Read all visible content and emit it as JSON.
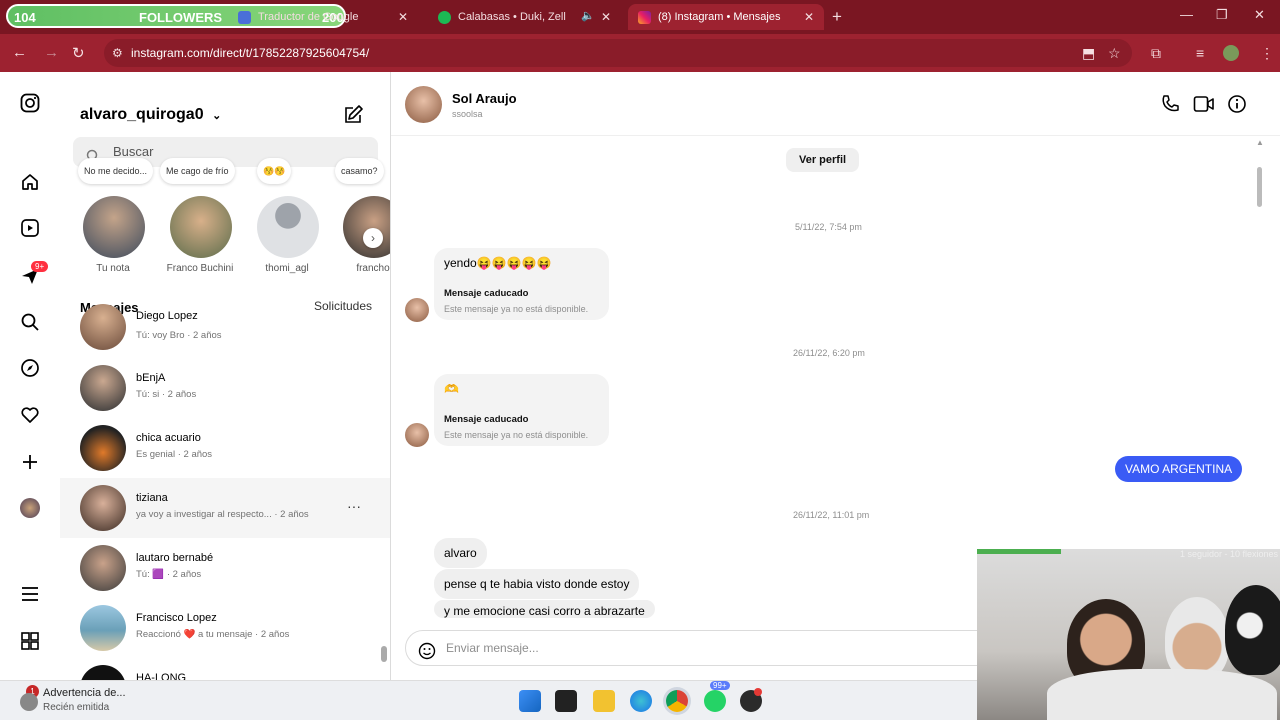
{
  "browser": {
    "overlay": {
      "left_num": "104",
      "label": "FOLLOWERS",
      "right_num": "200"
    },
    "tabs": [
      {
        "title": "Traductor de Google",
        "active": false
      },
      {
        "title": "Calabasas • Duki, Zell",
        "active": false
      },
      {
        "title": "(8) Instagram • Mensajes",
        "active": true
      }
    ],
    "url": "instagram.com/direct/t/17852287925604754/"
  },
  "rail": {
    "notif_badge": "9+"
  },
  "inbox": {
    "username": "alvaro_quiroga0",
    "search_placeholder": "Buscar",
    "notes": [
      {
        "bubble": "No me decido...",
        "name": "Tu nota"
      },
      {
        "bubble": "Me cago de frío",
        "name": "Franco Buchini"
      },
      {
        "bubble": "😚😚",
        "name": "thomi_agl"
      },
      {
        "bubble": "casamo?",
        "name": "francho"
      }
    ],
    "mensajes_label": "Mensajes",
    "solicitudes_label": "Solicitudes",
    "conversations": [
      {
        "name": "Diego Lopez",
        "preview": "Tú: voy Bro · 2 años"
      },
      {
        "name": "bEnjA",
        "preview": "Tú: si · 2 años"
      },
      {
        "name": "chica acuario",
        "preview": "Es genial · 2 años"
      },
      {
        "name": "tiziana",
        "preview": "ya voy a investigar al respecto... · 2 años"
      },
      {
        "name": "lautaro bernabé",
        "preview": "Tú: 🟪 · 2 años"
      },
      {
        "name": "Francisco Lopez",
        "preview": "Reaccionó ❤️ a tu mensaje · 2 años"
      },
      {
        "name": "HA-LONG",
        "preview": ""
      }
    ]
  },
  "chat": {
    "name": "Sol Araujo",
    "handle": "ssoolsa",
    "ver_perfil": "Ver perfil",
    "timestamps": [
      "5/11/22, 7:54 pm",
      "26/11/22, 6:20 pm",
      "26/11/22, 11:01 pm"
    ],
    "msg_yendo": "yendo😝😝😝😝😝",
    "expired_title": "Mensaje caducado",
    "expired_sub": "Este mensaje ya no está disponible.",
    "msg_vamo": "VAMO ARGENTINA",
    "msgs_late": [
      "alvaro",
      "pense q te habia visto donde estoy",
      "y me emocione casi corro a abrazarte"
    ],
    "composer_placeholder": "Enviar mensaje..."
  },
  "webcam": {
    "caption": "1 seguidor - 10 flexiones"
  },
  "taskbar": {
    "notif_title": "Advertencia de...",
    "notif_sub": "Recién emitida",
    "notif_count": "1",
    "badge_99": "99+"
  }
}
